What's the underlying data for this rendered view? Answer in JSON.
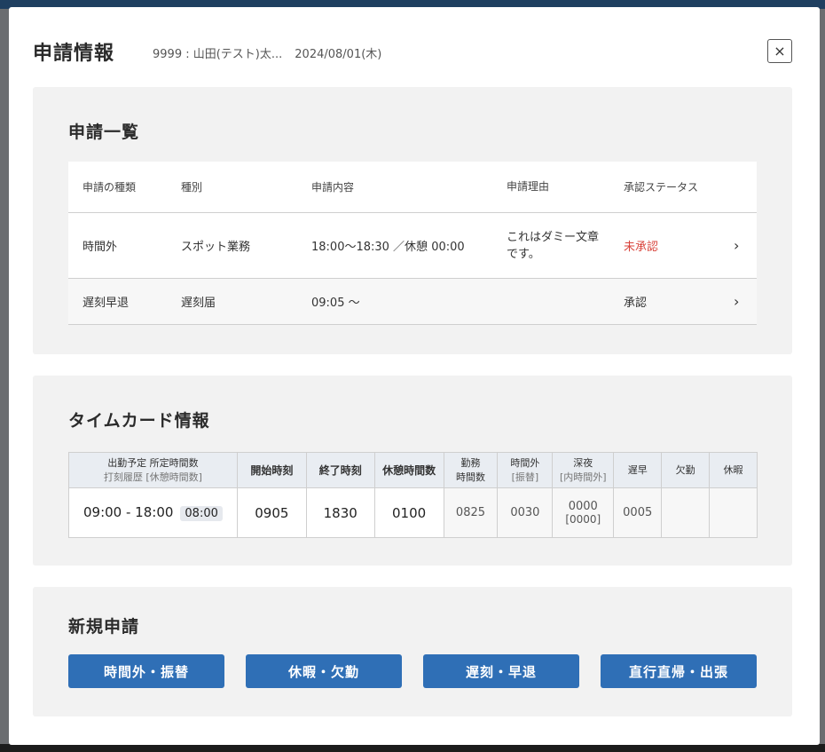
{
  "modal": {
    "title": "申請情報",
    "employee": "9999 : 山田(テスト)太...",
    "date": "2024/08/01(木)",
    "close_icon": "×"
  },
  "request_list": {
    "title": "申請一覧",
    "headers": [
      "申請の種類",
      "種別",
      "申請内容",
      "申請理由",
      "承認ステータス"
    ],
    "rows": [
      {
        "kind": "時間外",
        "type": "スポット業務",
        "content": "18:00〜18:30 ／休憩 00:00",
        "reason": "これはダミー文章です。",
        "status": "未承認"
      },
      {
        "kind": "遅刻早退",
        "type": "遅刻届",
        "content": "09:05 〜",
        "reason": "",
        "status": "承認"
      }
    ],
    "row_arrow": "›",
    "status_pending_color": "#d9453d"
  },
  "timecard": {
    "title": "タイムカード情報",
    "headers": {
      "plan_line1": "出勤予定  所定時間数",
      "plan_line2": "打刻履歴 [休憩時間数]",
      "start": "開始時刻",
      "end": "終了時刻",
      "break": "休憩時間数",
      "work_line1": "勤務",
      "work_line2": "時間数",
      "overtime_line1": "時間外",
      "overtime_line2": "[振替]",
      "night_line1": "深夜",
      "night_line2": "[内時間外]",
      "late": "遅早",
      "absent": "欠勤",
      "leave": "休暇"
    },
    "row": {
      "plan_time": "09:00 - 18:00",
      "plan_hours": "08:00",
      "start": "0905",
      "end": "1830",
      "break": "0100",
      "work": "0825",
      "overtime": "0030",
      "night": "0000",
      "night_sub": "[0000]",
      "late": "0005",
      "absent": "",
      "leave": ""
    }
  },
  "new_request": {
    "title": "新規申請",
    "buttons": [
      "時間外・振替",
      "休暇・欠勤",
      "遅刻・早退",
      "直行直帰・出張"
    ],
    "button_color": "#2f6fb6"
  }
}
